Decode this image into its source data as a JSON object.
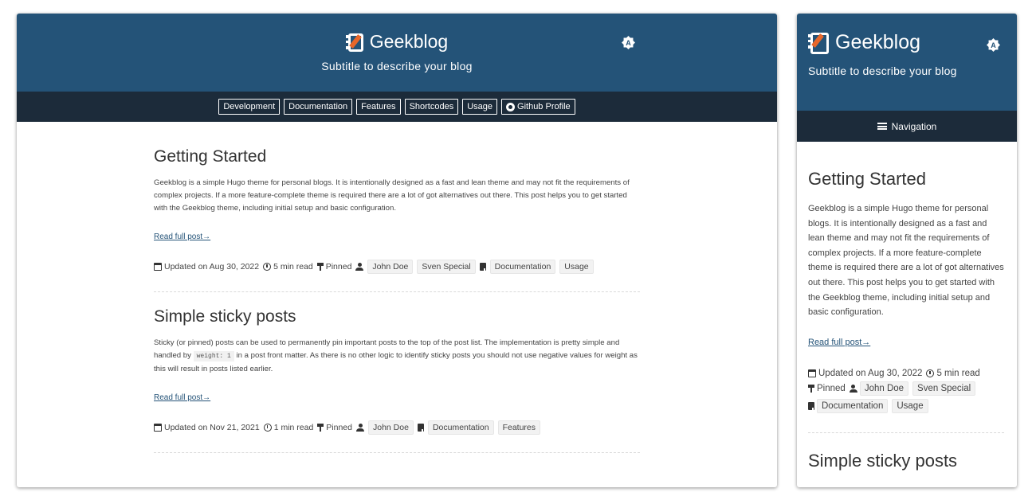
{
  "site": {
    "title": "Geekblog",
    "subtitle": "Subtitle to describe your blog",
    "theme_toggle_letter": "A"
  },
  "menu": {
    "items": [
      {
        "label": "Development"
      },
      {
        "label": "Documentation"
      },
      {
        "label": "Features"
      },
      {
        "label": "Shortcodes"
      },
      {
        "label": "Usage"
      },
      {
        "label": "Github Profile"
      }
    ],
    "mobile_label": "Navigation"
  },
  "posts": [
    {
      "title": "Getting Started",
      "body": "Geekblog is a simple Hugo theme for personal blogs. It is intentionally designed as a fast and lean theme and may not fit the requirements of complex projects. If a more feature-complete theme is required there are a lot of got alternatives out there. This post helps you to get started with the Geekblog theme, including initial setup and basic configuration.",
      "read_more": "Read full post→",
      "updated": "Updated on Aug 30, 2022",
      "read_time": "5 min read",
      "pinned": "Pinned",
      "authors": [
        "John Doe",
        "Sven Special"
      ],
      "tags": [
        "Documentation",
        "Usage"
      ]
    },
    {
      "title": "Simple sticky posts",
      "body_before": "Sticky (or pinned) posts can be used to permanently pin important posts to the top of the post list. The implementation is pretty simple and handled by ",
      "body_code": "weight: 1",
      "body_after": " in a post front matter. As there is no other logic to identify sticky posts you should not use negative values for weight as this will result in posts listed earlier.",
      "read_more": "Read full post→",
      "updated": "Updated on Nov 21, 2021",
      "read_time": "1 min read",
      "pinned": "Pinned",
      "authors": [
        "John Doe"
      ],
      "tags": [
        "Documentation",
        "Features"
      ]
    }
  ]
}
